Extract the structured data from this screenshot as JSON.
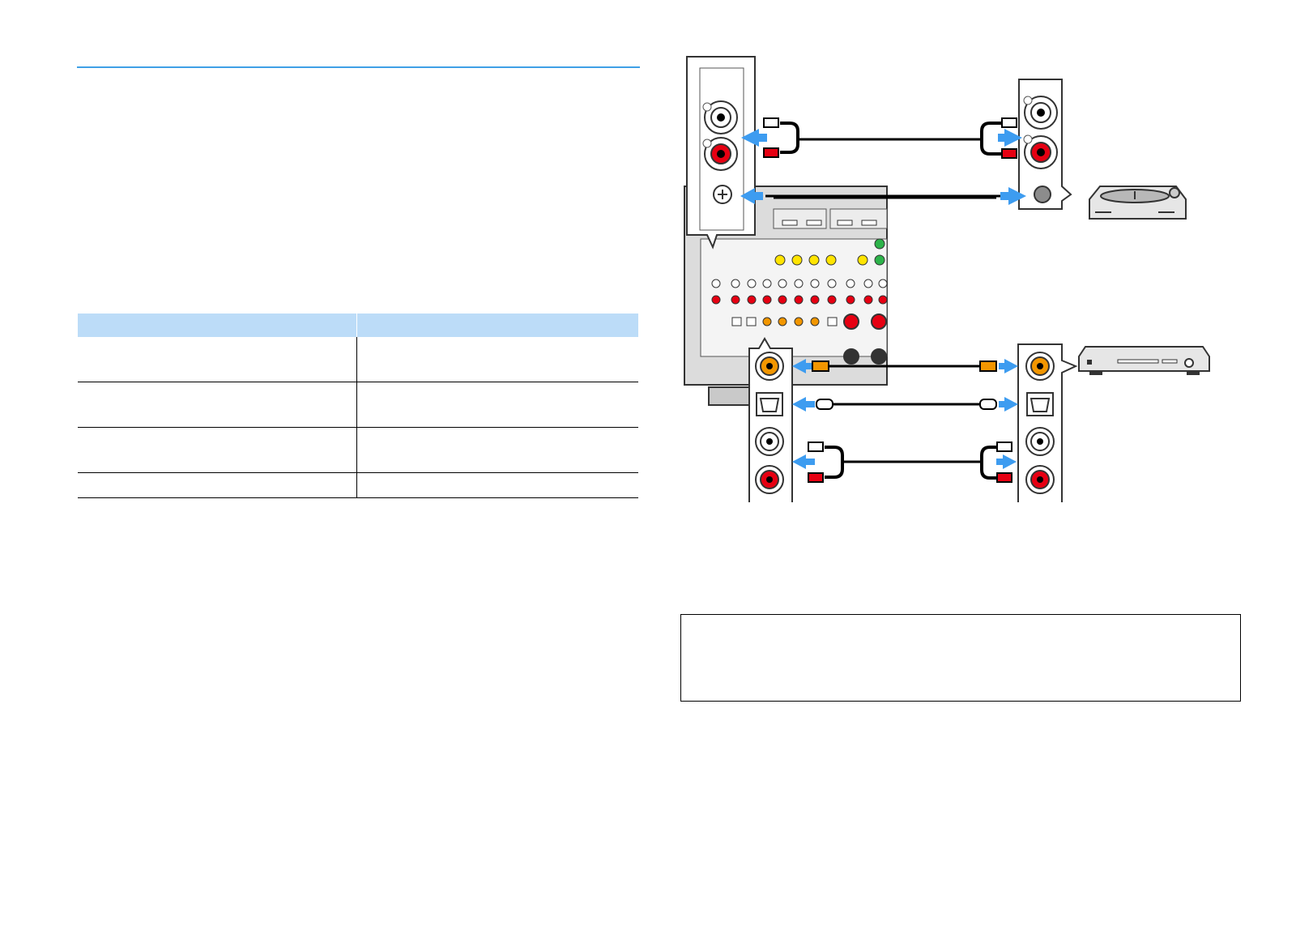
{
  "page": {
    "accent_color": "#3ea0e6",
    "table_header_color": "#bcdcf8"
  },
  "table": {
    "columns": [
      "",
      ""
    ],
    "rows": [
      [
        "",
        ""
      ],
      [
        "",
        ""
      ],
      [
        "",
        ""
      ],
      [
        "",
        ""
      ]
    ]
  },
  "note_box": {
    "text": ""
  },
  "diagram": {
    "arrow_color": "#3d9cf0",
    "left_panel_top": "left-audio-in-phono-gnd",
    "left_panel_bottom": "left-coax-optical-audio-in",
    "right_panel_top": "turntable-audio-out-gnd",
    "right_panel_bottom": "player-coax-optical-audio-out",
    "devices": [
      "turntable-icon",
      "cd-player-icon"
    ]
  }
}
